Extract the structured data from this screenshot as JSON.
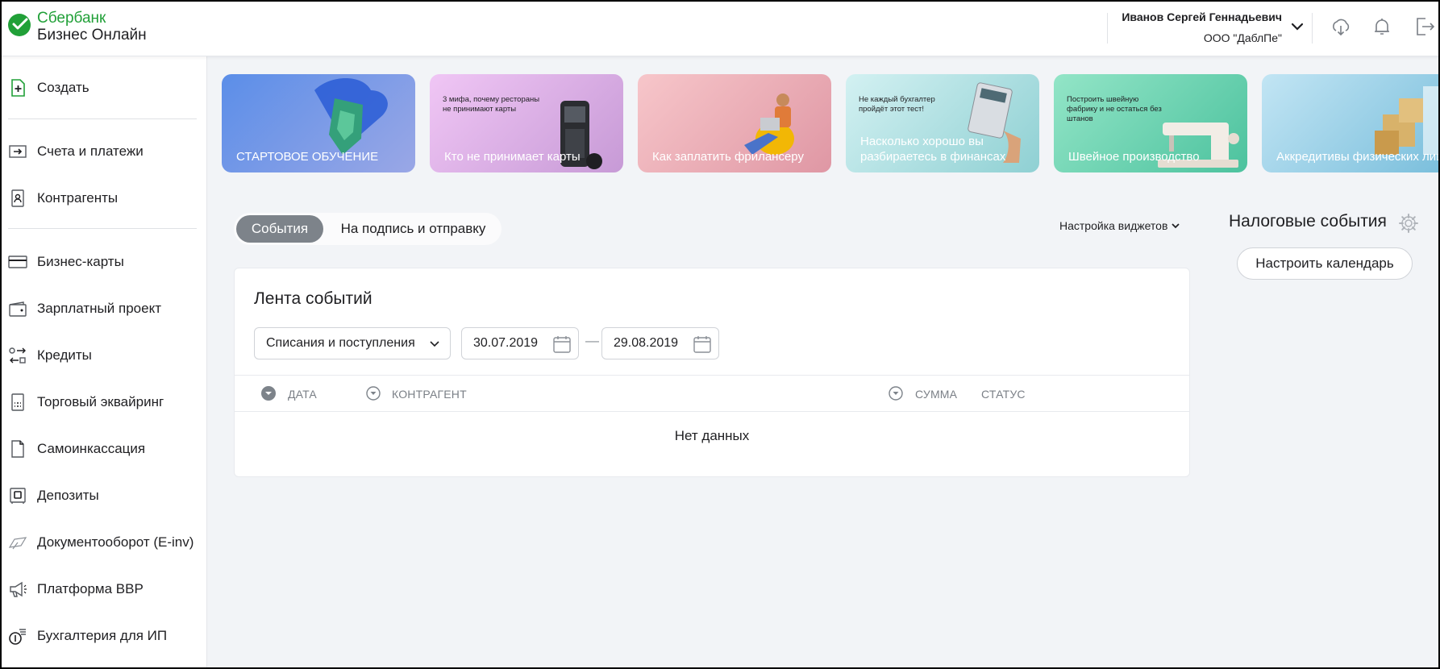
{
  "header": {
    "logo_line1": "Сбербанк",
    "logo_line2": "Бизнес Онлайн",
    "user_name": "Иванов Сергей Геннадьевич",
    "organization": "ООО \"ДаблПе\"",
    "icons": [
      "download-icon",
      "bell-icon",
      "logout-icon"
    ]
  },
  "sidebar": {
    "create_label": "Создать",
    "items": [
      {
        "label": "Счета и платежи",
        "icon": "arrow-in-box-icon"
      },
      {
        "label": "Контрагенты",
        "icon": "contact-card-icon"
      },
      {
        "label": "Бизнес-карты",
        "icon": "card-icon"
      },
      {
        "label": "Зарплатный проект",
        "icon": "wallet-icon"
      },
      {
        "label": "Кредиты",
        "icon": "exchange-icon"
      },
      {
        "label": "Торговый эквайринг",
        "icon": "pos-terminal-icon"
      },
      {
        "label": "Самоинкассация",
        "icon": "document-icon"
      },
      {
        "label": "Депозиты",
        "icon": "safe-icon"
      },
      {
        "label": "Документооборот (E-inv)",
        "icon": "doc-flow-icon"
      },
      {
        "label": "Платформа ВВР",
        "icon": "megaphone-icon"
      },
      {
        "label": "Бухгалтерия для ИП",
        "icon": "coins-icon"
      }
    ]
  },
  "banners": [
    {
      "title": "СТАРТОВОЕ ОБУЧЕНИЕ",
      "subtitle": "",
      "color_from": "#5b8ee8",
      "color_to": "#9aa7e6"
    },
    {
      "title": "Кто не принимает карты",
      "subtitle": "3 мифа, почему рестораны не принимают карты",
      "color_from": "#e9b9f0",
      "color_to": "#c79ad6"
    },
    {
      "title": "Как заплатить фрилансеру",
      "subtitle": "",
      "color_from": "#f6c5c9",
      "color_to": "#df97a4"
    },
    {
      "title": "Насколько хорошо вы разбираетесь в финансах",
      "subtitle": "Не каждый бухгалтер пройдёт этот тест!",
      "color_from": "#cdeff0",
      "color_to": "#8fd0d3"
    },
    {
      "title": "Швейное производство",
      "subtitle": "Построить швейную фабрику и не остаться без штанов",
      "color_from": "#8fe3c4",
      "color_to": "#4cc29e"
    },
    {
      "title": "Аккредитивы физических лиц",
      "subtitle": "",
      "color_from": "#bfe3f3",
      "color_to": "#7bbfdc"
    }
  ],
  "tabs": {
    "active": "События",
    "inactive": "На подпись и отправку"
  },
  "widget_settings_label": "Настройка виджетов",
  "events_card": {
    "title": "Лента событий",
    "filter_value": "Списания и поступления",
    "date_from": "30.07.2019",
    "date_to": "29.08.2019",
    "columns": [
      "ДАТА",
      "КОНТРАГЕНТ",
      "СУММА",
      "СТАТУС"
    ],
    "empty_text": "Нет данных"
  },
  "tax": {
    "title": "Налоговые события",
    "button_label": "Настроить календарь"
  },
  "colors": {
    "brand_green": "#21a038",
    "active_tab": "#7d838a",
    "page_bg": "#f2f4f7"
  }
}
